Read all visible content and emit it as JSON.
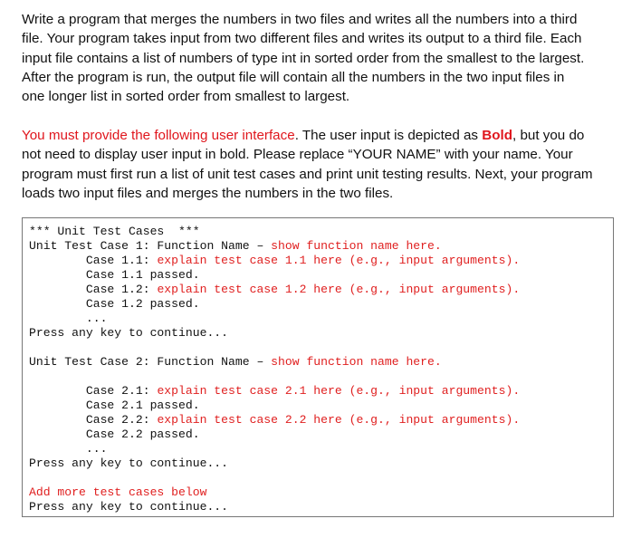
{
  "intro": {
    "lines": [
      "Write a program that merges the numbers in two files and writes all the numbers into a third",
      "file. Your program takes input from two different files and writes its output to a third file. Each",
      "input file contains a list of numbers of type int in sorted order from the smallest to the largest.",
      "After the program is run, the output file will contain all the numbers in the two input files in",
      "one longer list in sorted order from smallest to largest."
    ]
  },
  "requirements": {
    "red_lead": "You must provide the following user interface",
    "line1_mid": ". The user input is depicted as ",
    "bold_word": "Bold",
    "line1_end": ", but you do",
    "lines": [
      "not need to display user input in bold. Please replace “YOUR NAME” with your name. Your",
      "program must first run a list of unit test cases and print unit testing results. Next, your program",
      "loads two input files and merges the numbers in the two files."
    ]
  },
  "console": {
    "lines": [
      {
        "black": "*** Unit Test Cases  ***",
        "red": ""
      },
      {
        "black": "Unit Test Case 1: Function Name – ",
        "red": "show function name here."
      },
      {
        "black": "        Case 1.1: ",
        "red": "explain test case 1.1 here (e.g., input arguments)."
      },
      {
        "black": "        Case 1.1 passed.",
        "red": ""
      },
      {
        "black": "        Case 1.2: ",
        "red": "explain test case 1.2 here (e.g., input arguments)."
      },
      {
        "black": "        Case 1.2 passed.",
        "red": ""
      },
      {
        "black": "        ...",
        "red": ""
      },
      {
        "black": "Press any key to continue...",
        "red": ""
      },
      {
        "black": "",
        "red": ""
      },
      {
        "black": "Unit Test Case 2: Function Name – ",
        "red": "show function name here."
      },
      {
        "black": "",
        "red": ""
      },
      {
        "black": "        Case 2.1: ",
        "red": "explain test case 2.1 here (e.g., input arguments)."
      },
      {
        "black": "        Case 2.1 passed.",
        "red": ""
      },
      {
        "black": "        Case 2.2: ",
        "red": "explain test case 2.2 here (e.g., input arguments)."
      },
      {
        "black": "        Case 2.2 passed.",
        "red": ""
      },
      {
        "black": "        ...",
        "red": ""
      },
      {
        "black": "Press any key to continue...",
        "red": ""
      },
      {
        "black": "",
        "red": ""
      },
      {
        "black": "",
        "red": "Add more test cases below"
      },
      {
        "black": "Press any key to continue...",
        "red": ""
      }
    ]
  },
  "colors": {
    "accent_red": "#e0161d",
    "text": "#111111",
    "border": "#777777"
  }
}
